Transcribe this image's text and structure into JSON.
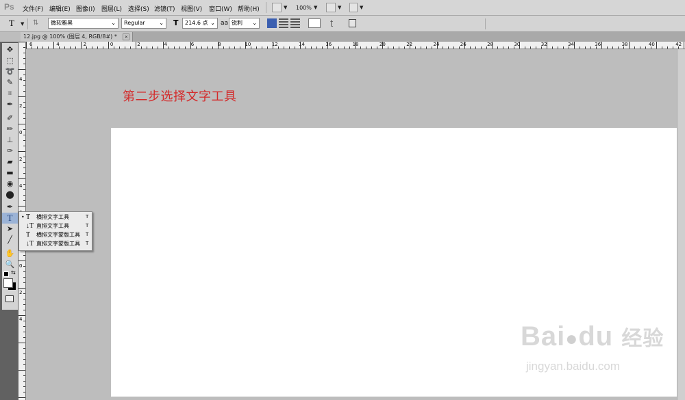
{
  "app": {
    "logo": "Ps"
  },
  "menu": [
    {
      "label": "文件(F)"
    },
    {
      "label": "编辑(E)"
    },
    {
      "label": "图像(I)"
    },
    {
      "label": "图层(L)"
    },
    {
      "label": "选择(S)"
    },
    {
      "label": "滤镜(T)"
    },
    {
      "label": "视图(V)"
    },
    {
      "label": "窗口(W)"
    },
    {
      "label": "帮助(H)"
    }
  ],
  "zoom": "100%",
  "options": {
    "tool_icon": "T",
    "font_family": "微软雅黑",
    "font_style": "Regular",
    "font_size": "214.6 点",
    "aa_icon": "aa",
    "antialias": "锐利"
  },
  "document_tab": {
    "title": "12.jpg @ 100% (图层 4, RGB/8#) *",
    "close": "×"
  },
  "ruler": {
    "h_labels": [
      "6",
      "4",
      "2",
      "0",
      "2",
      "4",
      "6",
      "8",
      "10",
      "12",
      "14",
      "16",
      "18",
      "20",
      "22",
      "24",
      "26",
      "28",
      "30",
      "32",
      "34",
      "36",
      "38",
      "40",
      "42"
    ],
    "v_labels": [
      "4",
      "2",
      "0",
      "2",
      "4",
      "6",
      "8",
      "0",
      "2",
      "4"
    ]
  },
  "flyout": {
    "items": [
      {
        "icon": "T",
        "label": "横排文字工具",
        "shortcut": "T",
        "active": true
      },
      {
        "icon": "↓T",
        "label": "直排文字工具",
        "shortcut": "T",
        "active": false
      },
      {
        "icon": "T",
        "label": "横排文字蒙版工具",
        "shortcut": "T",
        "active": false
      },
      {
        "icon": "↓T",
        "label": "直排文字蒙版工具",
        "shortcut": "T",
        "active": false
      }
    ]
  },
  "annotation": "第二步选择文字工具",
  "watermark": {
    "brand": "Bai",
    "brand2": "du",
    "cn": "经验",
    "url": "jingyan.baidu.com"
  },
  "colors": {
    "annotation": "#d42a2a",
    "workspace": "#bdbdbd",
    "canvas": "#ffffff"
  }
}
